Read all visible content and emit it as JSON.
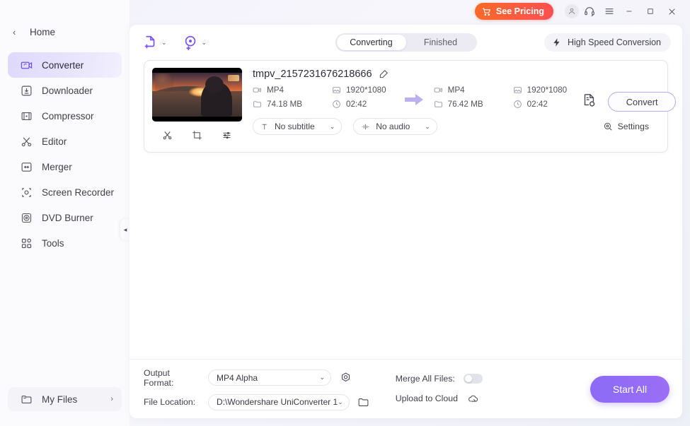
{
  "titlebar": {
    "pricing_label": "See Pricing",
    "cart_icon": "cart-icon",
    "account_icon": "account-icon",
    "support_icon": "headset-icon",
    "menu_icon": "hamburger-menu-icon",
    "minimize_label": "–",
    "maximize_label": "□",
    "close_label": "✕"
  },
  "sidebar": {
    "home_label": "Home",
    "back_chevron": "‹",
    "collapse_chevron": "◂",
    "items": [
      {
        "label": "Converter",
        "icon": "converter-icon",
        "active": true
      },
      {
        "label": "Downloader",
        "icon": "downloader-icon",
        "active": false
      },
      {
        "label": "Compressor",
        "icon": "compressor-icon",
        "active": false
      },
      {
        "label": "Editor",
        "icon": "editor-scissors-icon",
        "active": false
      },
      {
        "label": "Merger",
        "icon": "merger-icon",
        "active": false
      },
      {
        "label": "Screen Recorder",
        "icon": "screen-recorder-icon",
        "active": false
      },
      {
        "label": "DVD Burner",
        "icon": "dvd-burner-icon",
        "active": false
      },
      {
        "label": "Tools",
        "icon": "tools-grid-icon",
        "active": false
      }
    ],
    "my_files_label": "My Files",
    "my_files_icon": "folder-icon",
    "my_files_arrow": "›"
  },
  "toolbar": {
    "add_file_icon": "add-file-icon",
    "add_dvd_icon": "add-dvd-icon",
    "dropdown_chevron": "⌄",
    "tabs": [
      {
        "label": "Converting",
        "active": true
      },
      {
        "label": "Finished",
        "active": false
      }
    ],
    "high_speed_label": "High Speed Conversion",
    "high_speed_icon": "lightning-bolt-icon"
  },
  "file_card": {
    "filename": "tmpv_2157231676218666",
    "edit_icon": "edit-pencil-icon",
    "thumbnail_alt": "sunset-video-thumbnail",
    "thumb_tools": [
      {
        "icon": "scissors-trim-icon",
        "name": "trim"
      },
      {
        "icon": "crop-icon",
        "name": "crop"
      },
      {
        "icon": "effects-sliders-icon",
        "name": "effects"
      }
    ],
    "source": {
      "format": "MP4",
      "resolution": "1920*1080",
      "size": "74.18 MB",
      "duration": "02:42"
    },
    "target": {
      "format": "MP4",
      "resolution": "1920*1080",
      "size": "76.42 MB",
      "duration": "02:42"
    },
    "arrow_icon": "right-arrow-icon",
    "preset_icon": "document-gear-icon",
    "convert_label": "Convert",
    "subtitle_value": "No subtitle",
    "subtitle_icon": "subtitle-T-icon",
    "audio_value": "No audio",
    "audio_icon": "audio-wave-icon",
    "settings_label": "Settings",
    "settings_icon": "settings-gear-icon",
    "select_chevron": "⌄"
  },
  "footer": {
    "output_format_label": "Output Format:",
    "output_format_value": "MP4 Alpha",
    "output_format_icon": "format-camera-icon",
    "file_location_label": "File Location:",
    "file_location_value": "D:\\Wondershare UniConverter 1",
    "file_location_icon": "open-folder-icon",
    "merge_label": "Merge All Files:",
    "merge_on": false,
    "upload_label": "Upload to Cloud",
    "upload_icon": "cloud-upload-icon",
    "start_all_label": "Start All",
    "select_chevron": "⌄"
  },
  "colors": {
    "accent_purple": "#8c6bf5",
    "pricing_orange": "#fb6a28",
    "pricing_red": "#fb4f53",
    "sidebar_active": "#ded9fb",
    "panel_bg": "#ffffff"
  }
}
